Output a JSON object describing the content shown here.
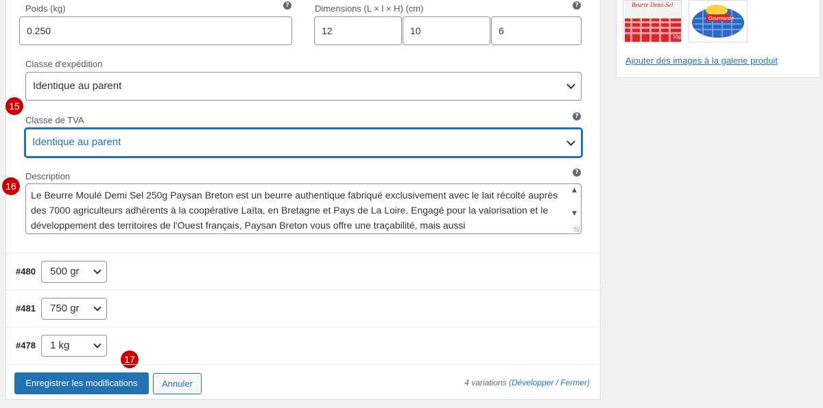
{
  "weight": {
    "label": "Poids (kg)",
    "value": "0.250"
  },
  "dimensions": {
    "label": "Dimensions (L × l × H) (cm)",
    "length": "12",
    "width": "10",
    "height": "6"
  },
  "shipping_class": {
    "label": "Classe d'expédition",
    "value": "Identique au parent"
  },
  "tax_class": {
    "label": "Classe de TVA",
    "value": "Identique au parent"
  },
  "description": {
    "label": "Description",
    "text": "Le Beurre Moulé Demi Sel 250g Paysan Breton est un beurre authentique fabriqué exclusivement avec le lait récolté auprès des 7000 agriculteurs adhérents à la coopérative Laïta, en Bretagne et Pays de La Loire. Engagé pour la valorisation et le développement des territoires de l'Ouest français, Paysan Breton vous offre une traçabilité, mais aussi"
  },
  "badges": {
    "b15": "15",
    "b16": "16",
    "b17": "17"
  },
  "help_icon": "?",
  "variations": [
    {
      "id": "#480",
      "value": "500 gr"
    },
    {
      "id": "#481",
      "value": "750 gr"
    },
    {
      "id": "#478",
      "value": "1 kg"
    }
  ],
  "footer": {
    "save_label": "Enregistrer les modifications",
    "cancel_label": "Annuler",
    "count_text": "4 variations",
    "expand_label": "Développer",
    "collapse_label": "Fermer"
  },
  "gallery": {
    "add_link": "Ajouter des images à la galerie produit",
    "thumb1_label": "Beurre Demi-Sel",
    "thumb1_weight": "10g",
    "thumb2_label": "Gourmande"
  },
  "colors": {
    "accent": "#2271b1",
    "badge": "#c80000"
  },
  "icons": [
    "help-icon",
    "chevron-down-icon",
    "scroll-up-icon",
    "scroll-down-icon"
  ]
}
